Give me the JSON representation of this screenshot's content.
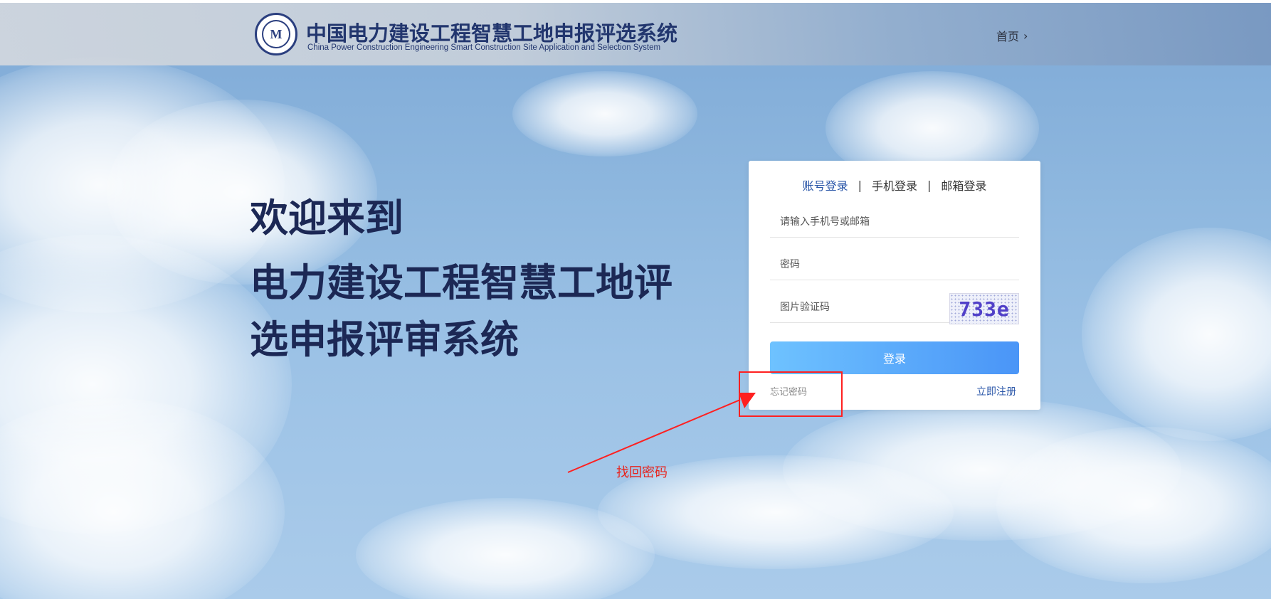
{
  "header": {
    "title": "中国电力建设工程智慧工地申报评选系统",
    "subtitle": "China Power Construction Engineering Smart Construction Site Application and Selection System",
    "emblem_text": "M",
    "home_label": "首页"
  },
  "hero": {
    "welcome": "欢迎来到",
    "system_name": "电力建设工程智慧工地评选申报评审系统"
  },
  "login": {
    "tabs": [
      {
        "label": "账号登录",
        "active": true
      },
      {
        "label": "手机登录",
        "active": false
      },
      {
        "label": "邮箱登录",
        "active": false
      }
    ],
    "separator": "|",
    "account_placeholder": "请输入手机号或邮箱",
    "password_placeholder": "密码",
    "captcha_placeholder": "图片验证码",
    "captcha_code": "733e",
    "login_button": "登录",
    "forgot_password": "忘记密码",
    "register": "立即注册"
  },
  "annotation": {
    "text": "找回密码",
    "color": "#ff2020"
  },
  "colors": {
    "brand": "#22366e",
    "accent": "#2a56a8",
    "button_start": "#6ec2ff",
    "button_end": "#4a95f7",
    "annotation": "#e8231c"
  }
}
